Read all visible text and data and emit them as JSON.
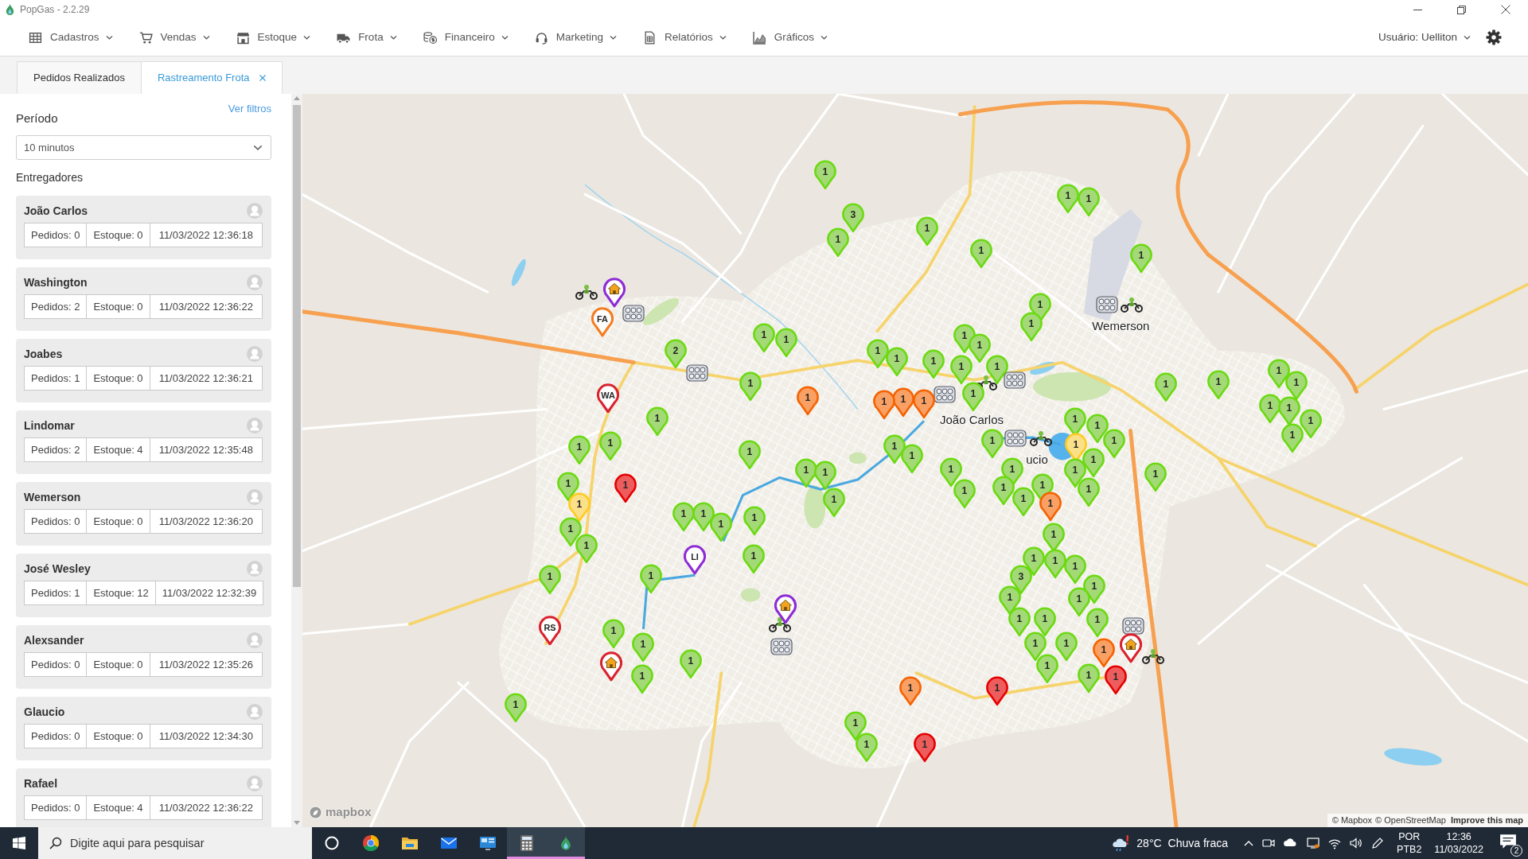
{
  "window": {
    "title": "PopGas - 2.2.29"
  },
  "menu": [
    "Cadastros",
    "Vendas",
    "Estoque",
    "Frota",
    "Financeiro",
    "Marketing",
    "Relatórios",
    "Gráficos"
  ],
  "user_menu": "Usuário: Uelliton",
  "tabs": [
    {
      "label": "Pedidos Realizados",
      "selected": false,
      "closable": false
    },
    {
      "label": "Rastreamento Frota",
      "selected": true,
      "closable": true
    }
  ],
  "sidebar": {
    "filters_link": "Ver filtros",
    "period_label": "Período",
    "period_select": {
      "value": "10 minutos"
    },
    "couriers_label": "Entregadores",
    "couriers": [
      {
        "name": "João Carlos",
        "orders": "Pedidos: 0",
        "stock": "Estoque: 0",
        "updated": "11/03/2022 12:36:18"
      },
      {
        "name": "Washington",
        "orders": "Pedidos: 2",
        "stock": "Estoque: 0",
        "updated": "11/03/2022 12:36:22"
      },
      {
        "name": "Joabes",
        "orders": "Pedidos: 1",
        "stock": "Estoque: 0",
        "updated": "11/03/2022 12:36:21"
      },
      {
        "name": "Lindomar",
        "orders": "Pedidos: 2",
        "stock": "Estoque: 4",
        "updated": "11/03/2022 12:35:48"
      },
      {
        "name": "Wemerson",
        "orders": "Pedidos: 0",
        "stock": "Estoque: 0",
        "updated": "11/03/2022 12:36:20"
      },
      {
        "name": "José Wesley",
        "orders": "Pedidos: 1",
        "stock": "Estoque: 12",
        "updated": "11/03/2022 12:32:39"
      },
      {
        "name": "Alexsander",
        "orders": "Pedidos: 0",
        "stock": "Estoque: 0",
        "updated": "11/03/2022 12:35:26"
      },
      {
        "name": "Glaucio",
        "orders": "Pedidos: 0",
        "stock": "Estoque: 0",
        "updated": "11/03/2022 12:34:30"
      },
      {
        "name": "Rafael",
        "orders": "Pedidos: 0",
        "stock": "Estoque: 4",
        "updated": "11/03/2022 12:36:22"
      }
    ]
  },
  "map": {
    "order_markers": [
      {
        "label": "1",
        "color": "#a3d977"
      },
      {
        "label": "1",
        "color": "#a3d977"
      },
      {
        "label": "1",
        "color": "#a3d977"
      },
      {
        "label": "3",
        "color": "#a3d977"
      },
      {
        "label": "1",
        "color": "#a3d977"
      },
      {
        "label": "1",
        "color": "#a3d977"
      },
      {
        "label": "1",
        "color": "#a3d977"
      },
      {
        "label": "1",
        "color": "#a3d977"
      },
      {
        "label": "1",
        "color": "#a3d977"
      },
      {
        "label": "1",
        "color": "#a3d977"
      },
      {
        "label": "1",
        "color": "#a3d977"
      },
      {
        "label": "1",
        "color": "#a3d977"
      },
      {
        "label": "1",
        "color": "#a3d977"
      },
      {
        "label": "2",
        "color": "#a3d977"
      },
      {
        "label": "1",
        "color": "#a3d977"
      },
      {
        "label": "1",
        "color": "#a3d977"
      },
      {
        "label": "1",
        "color": "#a3d977"
      },
      {
        "label": "1",
        "color": "#a3d977"
      },
      {
        "label": "1",
        "color": "#a3d977"
      },
      {
        "label": "1",
        "color": "#a3d977"
      },
      {
        "label": "1",
        "color": "#a3d977"
      },
      {
        "label": "1",
        "color": "#a3d977"
      },
      {
        "label": "1",
        "color": "#a3d977"
      },
      {
        "label": "1",
        "color": "#a3d977"
      },
      {
        "label": "1",
        "color": "#a3d977"
      },
      {
        "label": "1",
        "color": "#f9a064"
      },
      {
        "label": "1",
        "color": "#f9a064"
      },
      {
        "label": "1",
        "color": "#f9a064"
      },
      {
        "label": "1",
        "color": "#f9a064"
      },
      {
        "label": "1",
        "color": "#a3d977"
      },
      {
        "label": "1",
        "color": "#a3d977"
      },
      {
        "label": "1",
        "color": "#a3d977"
      },
      {
        "label": "1",
        "color": "#a3d977"
      },
      {
        "label": "1",
        "color": "#a3d977"
      },
      {
        "label": "1",
        "color": "#a3d977"
      },
      {
        "label": "1",
        "color": "#a3d977"
      },
      {
        "label": "1",
        "color": "#a3d977"
      },
      {
        "label": "1",
        "color": "#a3d977"
      },
      {
        "label": "1",
        "color": "#a3d977"
      },
      {
        "label": "1",
        "color": "#a3d977"
      },
      {
        "label": "1",
        "color": "#a3d977"
      },
      {
        "label": "1",
        "color": "#fbe08a"
      },
      {
        "label": "1",
        "color": "#a3d977"
      },
      {
        "label": "1",
        "color": "#a3d977"
      },
      {
        "label": "1",
        "color": "#a3d977"
      },
      {
        "label": "1",
        "color": "#a3d977"
      },
      {
        "label": "1",
        "color": "#a3d977"
      },
      {
        "label": "1",
        "color": "#a3d977"
      },
      {
        "label": "1",
        "color": "#a3d977"
      },
      {
        "label": "1",
        "color": "#a3d977"
      },
      {
        "label": "1",
        "color": "#a3d977"
      },
      {
        "label": "1",
        "color": "#a3d977"
      },
      {
        "label": "1",
        "color": "#a3d977"
      },
      {
        "label": "1",
        "color": "#ee5d5d"
      },
      {
        "label": "1",
        "color": "#a3d977"
      },
      {
        "label": "1",
        "color": "#a3d977"
      },
      {
        "label": "1",
        "color": "#a3d977"
      },
      {
        "label": "1",
        "color": "#a3d977"
      },
      {
        "label": "1",
        "color": "#fbe08a"
      },
      {
        "label": "1",
        "color": "#a3d977"
      },
      {
        "label": "1",
        "color": "#a3d977"
      },
      {
        "label": "1",
        "color": "#f9a064"
      },
      {
        "label": "1",
        "color": "#a3d977"
      },
      {
        "label": "1",
        "color": "#a3d977"
      },
      {
        "label": "1",
        "color": "#a3d977"
      },
      {
        "label": "1",
        "color": "#a3d977"
      },
      {
        "label": "1",
        "color": "#a3d977"
      },
      {
        "label": "1",
        "color": "#a3d977"
      },
      {
        "label": "1",
        "color": "#a3d977"
      },
      {
        "label": "1",
        "color": "#a3d977"
      },
      {
        "label": "1",
        "color": "#a3d977"
      },
      {
        "label": "1",
        "color": "#a3d977"
      },
      {
        "label": "1",
        "color": "#a3d977"
      },
      {
        "label": "1",
        "color": "#a3d977"
      },
      {
        "label": "1",
        "color": "#a3d977"
      },
      {
        "label": "3",
        "color": "#a3d977"
      },
      {
        "label": "1",
        "color": "#a3d977"
      },
      {
        "label": "1",
        "color": "#a3d977"
      },
      {
        "label": "1",
        "color": "#a3d977"
      },
      {
        "label": "1",
        "color": "#a3d977"
      },
      {
        "label": "1",
        "color": "#a3d977"
      },
      {
        "label": "1",
        "color": "#a3d977"
      },
      {
        "label": "1",
        "color": "#a3d977"
      },
      {
        "label": "1",
        "color": "#a3d977"
      },
      {
        "label": "1",
        "color": "#a3d977"
      },
      {
        "label": "1",
        "color": "#a3d977"
      },
      {
        "label": "1",
        "color": "#f9a064"
      },
      {
        "label": "1",
        "color": "#a3d977"
      },
      {
        "label": "1",
        "color": "#a3d977"
      },
      {
        "label": "1",
        "color": "#a3d977"
      },
      {
        "label": "1",
        "color": "#a3d977"
      },
      {
        "label": "1",
        "color": "#ee5d5d"
      },
      {
        "label": "1",
        "color": "#f9a064"
      },
      {
        "label": "1",
        "color": "#ee5d5d"
      },
      {
        "label": "1",
        "color": "#a3d977"
      },
      {
        "label": "1",
        "color": "#a3d977"
      },
      {
        "label": "1",
        "color": "#a3d977"
      },
      {
        "label": "1",
        "color": "#ee5d5d"
      }
    ],
    "driver_markers": [
      {
        "label": "FA",
        "color": "#f47c20"
      },
      {
        "label": "WA",
        "color": "#d9232e"
      },
      {
        "label": "LI",
        "color": "#8e2bd6"
      },
      {
        "label": "RS",
        "color": "#d9232e"
      }
    ],
    "home_markers": [
      {
        "color": "#8e2bd6"
      },
      {
        "color": "#8e2bd6"
      },
      {
        "color": "#d9232e"
      },
      {
        "color": "#d9232e"
      }
    ],
    "vehicle_labels": [
      "Wemerson",
      "João Carlos",
      "ucio"
    ],
    "logo": "mapbox",
    "attribution": [
      "© Mapbox",
      "© OpenStreetMap"
    ],
    "improve_link": "Improve this map"
  },
  "taskbar": {
    "search": {
      "placeholder": "Digite aqui para pesquisar"
    },
    "apps": [
      {
        "running": false
      },
      {
        "running": false
      },
      {
        "running": false
      },
      {
        "running": false
      },
      {
        "running": false
      },
      {
        "running": true
      },
      {
        "running": true
      }
    ],
    "weather": {
      "temperature": "28°C",
      "condition": "Chuva fraca"
    },
    "language": [
      "POR",
      "PTB2"
    ],
    "time": "12:36",
    "date": "11/03/2022",
    "notifications": "2"
  }
}
